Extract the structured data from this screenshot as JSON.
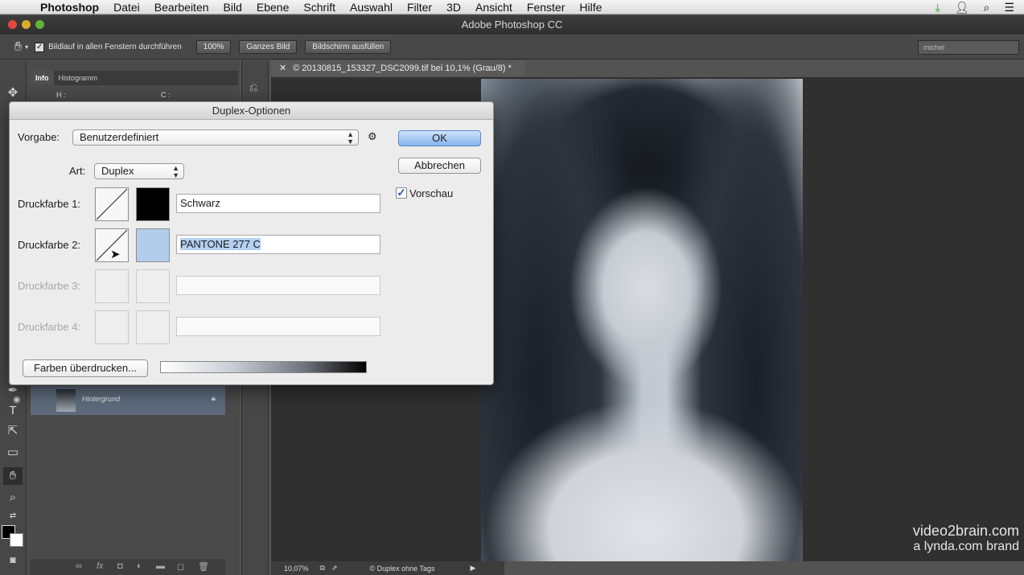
{
  "menubar": {
    "app": "Photoshop",
    "items": [
      "Datei",
      "Bearbeiten",
      "Bild",
      "Ebene",
      "Schrift",
      "Auswahl",
      "Filter",
      "3D",
      "Ansicht",
      "Fenster",
      "Hilfe"
    ]
  },
  "window": {
    "title": "Adobe Photoshop CC"
  },
  "optionsbar": {
    "scroll_all": "Bildlauf in allen Fenstern durchführen",
    "zoom100": "100%",
    "fit_screen": "Ganzes Bild",
    "fill_screen": "Bildschirm ausfüllen",
    "workspace": "michel"
  },
  "panels": {
    "tabs": [
      "Info",
      "Histogramm"
    ],
    "info_h": "H :",
    "info_c": "C :",
    "layer_name": "Hintergrund"
  },
  "document": {
    "tab_title": "© 20130815_153327_DSC2099.tif bei 10,1% (Grau/8) *",
    "zoom": "10,07%",
    "status": "© Duplex ohne Tags"
  },
  "watermark": {
    "line1": "video2brain.com",
    "line2": "a lynda.com brand"
  },
  "dialog": {
    "title": "Duplex-Optionen",
    "preset_label": "Vorgabe:",
    "preset_value": "Benutzerdefiniert",
    "type_label": "Art:",
    "type_value": "Duplex",
    "ok": "OK",
    "cancel": "Abbrechen",
    "preview": "Vorschau",
    "overprint": "Farben überdrucken...",
    "inks": [
      {
        "label": "Druckfarbe 1:",
        "name": "Schwarz",
        "color": "#000000"
      },
      {
        "label": "Druckfarbe 2:",
        "name": "PANTONE 277 C",
        "color": "#b2cdeb"
      },
      {
        "label": "Druckfarbe 3:",
        "name": ""
      },
      {
        "label": "Druckfarbe 4:",
        "name": ""
      }
    ]
  }
}
